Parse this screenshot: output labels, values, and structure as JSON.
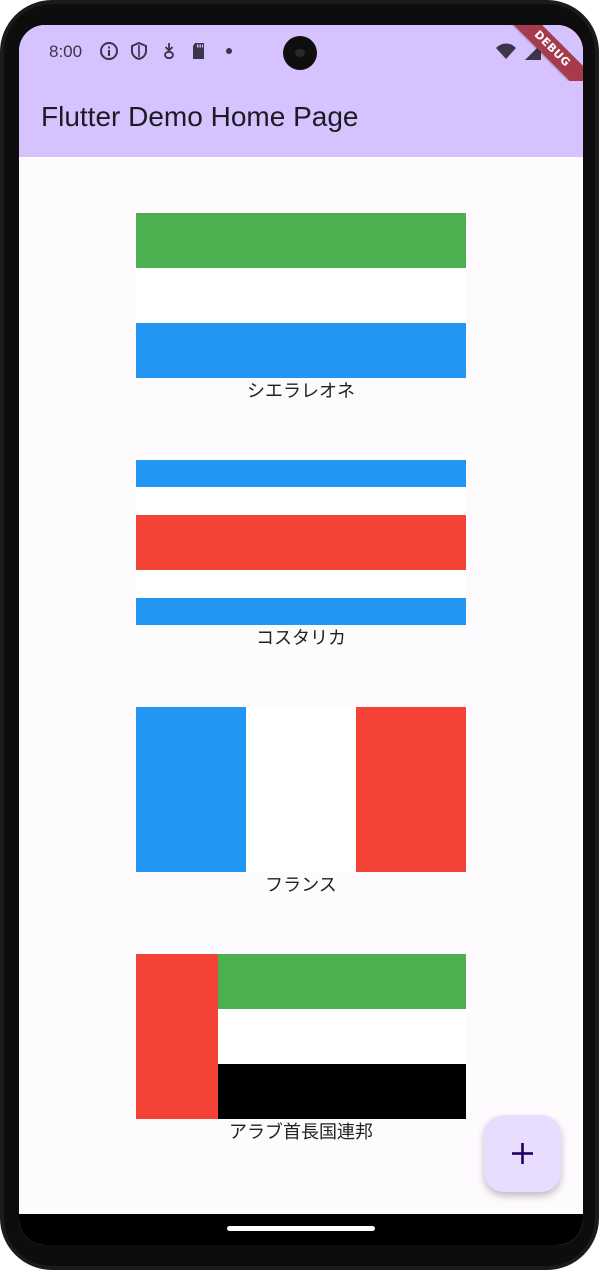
{
  "status_bar": {
    "time": "8:00",
    "icons_left": [
      "info-icon",
      "shield-icon",
      "download-icon",
      "sd-card-icon",
      "dot-icon"
    ],
    "icons_right": [
      "wifi-icon",
      "cell-signal-icon",
      "battery-icon"
    ]
  },
  "debug_banner": "DEBUG",
  "app_bar": {
    "title": "Flutter Demo Home Page"
  },
  "colors": {
    "app_bar": "#d6c2ff",
    "body_background": "#fefbff",
    "green": "#4caf50",
    "white": "#ffffff",
    "blue": "#2196f3",
    "red": "#f44336",
    "black": "#000000",
    "fab_background": "#e9ddff",
    "fab_icon": "#21005d"
  },
  "flags": [
    {
      "label": "シエラレオネ"
    },
    {
      "label": "コスタリカ"
    },
    {
      "label": "フランス"
    },
    {
      "label": "アラブ首長国連邦"
    }
  ],
  "fab": {
    "icon": "plus-icon"
  }
}
